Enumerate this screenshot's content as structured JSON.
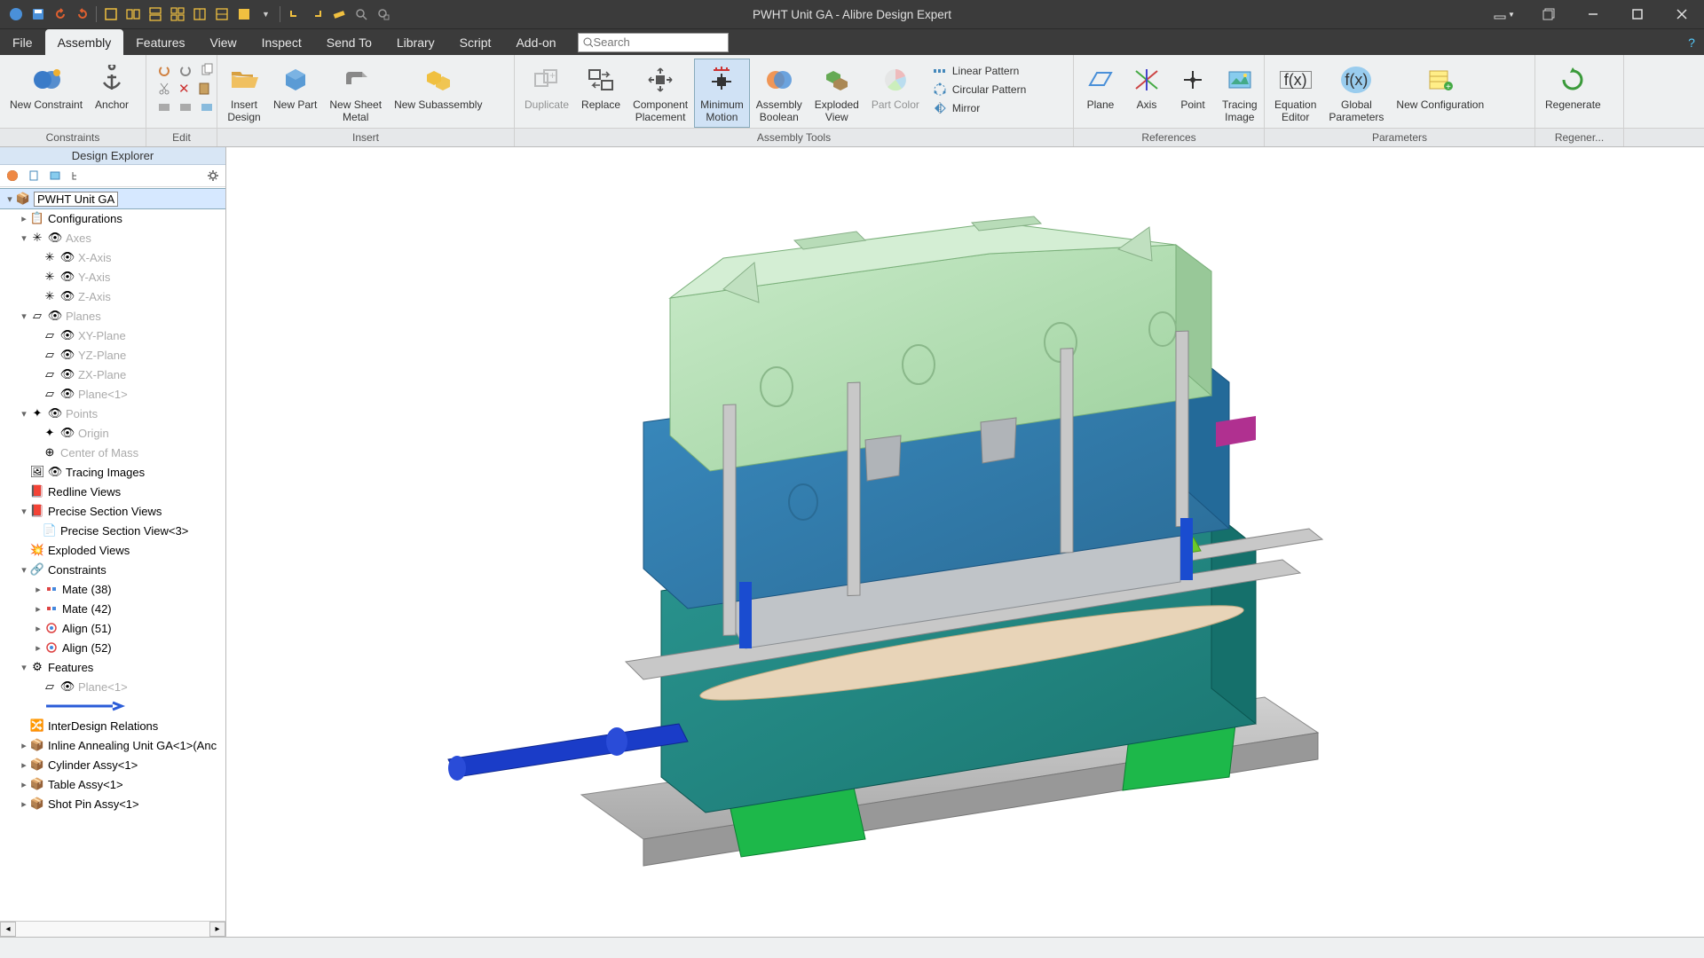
{
  "title": "PWHT Unit GA - Alibre Design Expert",
  "menu": {
    "file": "File",
    "assembly": "Assembly",
    "features": "Features",
    "view": "View",
    "inspect": "Inspect",
    "sendto": "Send To",
    "library": "Library",
    "script": "Script",
    "addon": "Add-on",
    "search_placeholder": "Search"
  },
  "ribbon": {
    "groups": {
      "constraints": "Constraints",
      "edit": "Edit",
      "insert": "Insert",
      "assembly_tools": "Assembly Tools",
      "references": "References",
      "parameters": "Parameters",
      "regen": "Regener..."
    },
    "buttons": {
      "new_constraint": "New Constraint",
      "anchor": "Anchor",
      "insert_design": "Insert\nDesign",
      "new_part": "New Part",
      "new_sheet_metal": "New Sheet\nMetal",
      "new_subassembly": "New Subassembly",
      "duplicate": "Duplicate",
      "replace": "Replace",
      "component_placement": "Component\nPlacement",
      "minimum_motion": "Minimum\nMotion",
      "assembly_boolean": "Assembly\nBoolean",
      "exploded_view": "Exploded\nView",
      "part_color": "Part Color",
      "linear_pattern": "Linear Pattern",
      "circular_pattern": "Circular Pattern",
      "mirror": "Mirror",
      "plane": "Plane",
      "axis": "Axis",
      "point": "Point",
      "tracing_image": "Tracing\nImage",
      "equation_editor": "Equation\nEditor",
      "global_parameters": "Global\nParameters",
      "new_configuration": "New Configuration",
      "regenerate": "Regenerate"
    }
  },
  "explorer": {
    "title": "Design Explorer",
    "root": "PWHT Unit GA",
    "configurations": "Configurations",
    "axes": "Axes",
    "x_axis": "X-Axis",
    "y_axis": "Y-Axis",
    "z_axis": "Z-Axis",
    "planes": "Planes",
    "xy_plane": "XY-Plane",
    "yz_plane": "YZ-Plane",
    "zx_plane": "ZX-Plane",
    "plane1": "Plane<1>",
    "points": "Points",
    "origin": "Origin",
    "center_of_mass": "Center of Mass",
    "tracing_images": "Tracing Images",
    "redline_views": "Redline Views",
    "precise_section_views": "Precise Section Views",
    "precise_section_view3": "Precise Section View<3>",
    "exploded_views": "Exploded Views",
    "constraints": "Constraints",
    "mate38": "Mate (38)",
    "mate42": "Mate (42)",
    "align51": "Align (51)",
    "align52": "Align (52)",
    "features": "Features",
    "feature_plane1": "Plane<1>",
    "interdesign": "InterDesign Relations",
    "inline_annealing": "Inline Annealing Unit GA<1>(Anc",
    "cylinder_assy": "Cylinder Assy<1>",
    "table_assy": "Table Assy<1>",
    "shot_pin_assy": "Shot Pin Assy<1>"
  }
}
